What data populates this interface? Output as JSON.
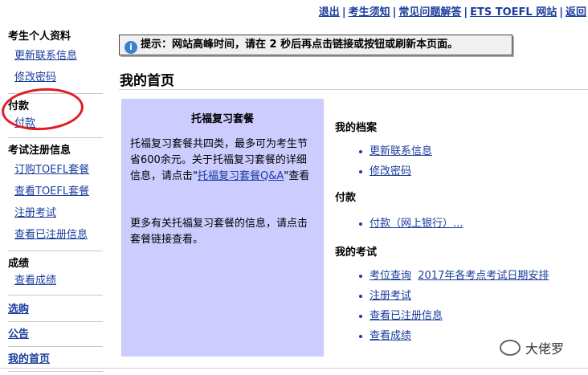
{
  "topnav": {
    "logout": "退出",
    "notice": "考生须知",
    "faq": "常见问题解答",
    "ets": "ETS TOEFL 网站",
    "back": "返回",
    "separator": "|"
  },
  "sidebar": {
    "profile": {
      "title": "考生个人资料",
      "items": [
        "更新联系信息",
        "修改密码"
      ]
    },
    "payment": {
      "title": "付款",
      "items": [
        "付款"
      ]
    },
    "registration": {
      "title": "考试注册信息",
      "items": [
        "订购TOEFL套餐",
        "查看TOEFL套餐",
        "注册考试",
        "查看已注册信息"
      ]
    },
    "scores": {
      "title": "成绩",
      "items": [
        "查看成绩"
      ]
    },
    "links": [
      "选购",
      "公告",
      "我的首页"
    ]
  },
  "notice": {
    "icon": "info-icon",
    "text": "提示：网站高峰时间，请在 2 秒后再点击链接或按钮或刷新本页面。"
  },
  "page_title": "我的首页",
  "panel": {
    "title": "托福复习套餐",
    "text_before": "托福复习套餐共四类，最多可为考生节省600余元。关于托福复习套餐的详细信息，请点击\"",
    "link": "托福复习套餐Q&A",
    "text_after": "\"查看",
    "text2": "更多有关托福复习套餐的信息，请点击套餐链接查看。"
  },
  "right": {
    "profile": {
      "title": "我的档案",
      "items": [
        "更新联系信息",
        "修改密码"
      ]
    },
    "payment": {
      "title": "付款",
      "items": [
        "付款（网上银行）..."
      ]
    },
    "exams": {
      "title": "我的考试",
      "seat_query": "考位查询",
      "schedule": "2017年各考点考试日期安排",
      "items": [
        "注册考试",
        "查看已注册信息",
        "查看成绩"
      ]
    }
  },
  "watermark": {
    "text": "大佬罗"
  },
  "colors": {
    "link": "#1a3d9c",
    "panel_bg": "#ccccff",
    "annotation": "#e01b24"
  }
}
